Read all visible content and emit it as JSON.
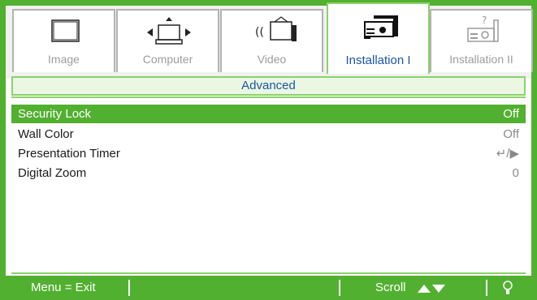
{
  "tabs": [
    {
      "label": "Image",
      "icon": "image-icon"
    },
    {
      "label": "Computer",
      "icon": "computer-icon"
    },
    {
      "label": "Video",
      "icon": "video-icon"
    },
    {
      "label": "Installation I",
      "icon": "projector-icon"
    },
    {
      "label": "Installation II",
      "icon": "projector-settings-icon"
    }
  ],
  "submenu_title": "Advanced",
  "rows": [
    {
      "name": "Security Lock",
      "value": "Off"
    },
    {
      "name": "Wall Color",
      "value": "Off"
    },
    {
      "name": "Presentation Timer",
      "value": "↵/▶"
    },
    {
      "name": "Digital Zoom",
      "value": "0"
    }
  ],
  "footer": {
    "menu_exit": "Menu = Exit",
    "scroll": "Scroll",
    "scroll_icon": "up-down-arrow-icon",
    "tip_icon": "lightbulb-icon"
  },
  "colors": {
    "accent_green": "#52b030",
    "active_text_blue": "#1c55a8",
    "light_green_bg": "#ebf7e3"
  }
}
